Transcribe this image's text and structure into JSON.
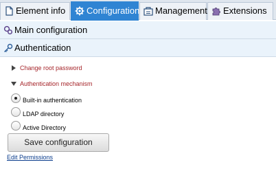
{
  "tabs": [
    {
      "label": "Element info",
      "icon": "document-icon",
      "active": false
    },
    {
      "label": "Configuration",
      "icon": "gear-icon",
      "active": true
    },
    {
      "label": "Management",
      "icon": "management-icon",
      "active": false
    },
    {
      "label": "Extensions",
      "icon": "puzzle-icon",
      "active": false
    }
  ],
  "sections": {
    "main_configuration": {
      "label": "Main configuration",
      "icon": "config-icon"
    },
    "authentication": {
      "label": "Authentication",
      "icon": "key-icon"
    }
  },
  "tree": {
    "change_root_password": "Change root password",
    "authentication_mechanism": "Authentication mechanism"
  },
  "auth_options": [
    {
      "label": "Built-in authentication",
      "checked": true
    },
    {
      "label": "LDAP directory",
      "checked": false
    },
    {
      "label": "Active Directory",
      "checked": false
    }
  ],
  "save_button": "Save configuration",
  "edit_permissions_link": "Edit Permissions",
  "colors": {
    "accent": "#2f84d3",
    "tree_link": "#a5252a",
    "link": "#0a3c8c",
    "section_bg": "#eaf3fb"
  }
}
